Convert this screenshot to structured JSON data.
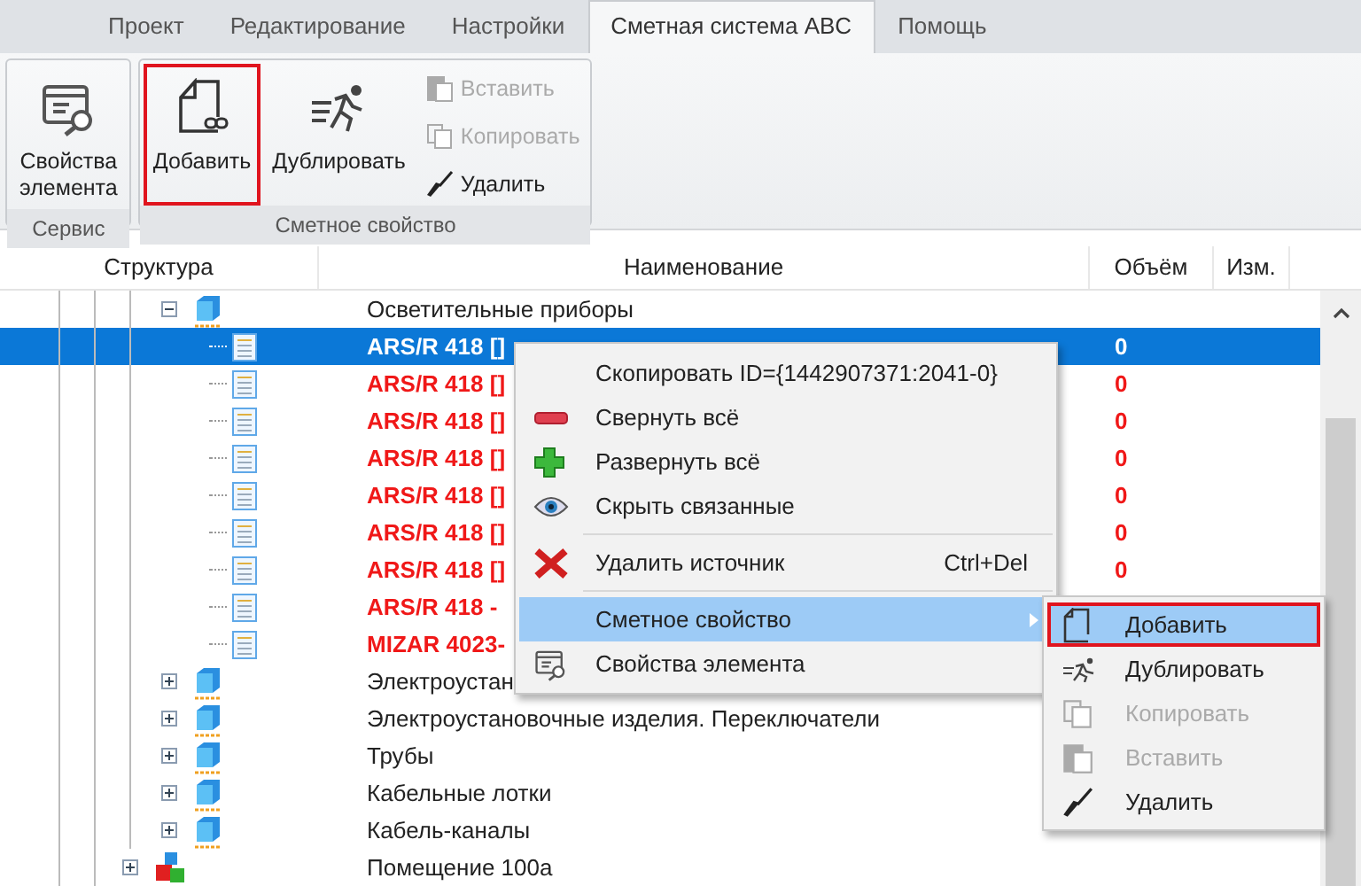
{
  "tabs": [
    {
      "label": "Проект",
      "selected": false
    },
    {
      "label": "Редактирование",
      "selected": false
    },
    {
      "label": "Настройки",
      "selected": false
    },
    {
      "label": "Сметная система ABC",
      "selected": true
    },
    {
      "label": "Помощь",
      "selected": false
    }
  ],
  "ribbon": {
    "groups": [
      {
        "title": "Сервис",
        "large_buttons": [
          {
            "label": "Свойства элемента",
            "outlined": false
          }
        ]
      },
      {
        "title": "Сметное свойство",
        "large_buttons": [
          {
            "label": "Добавить",
            "outlined": true
          },
          {
            "label": "Дублировать",
            "outlined": false
          }
        ],
        "small_buttons": [
          {
            "label": "Вставить",
            "disabled": true
          },
          {
            "label": "Копировать",
            "disabled": true
          },
          {
            "label": "Удалить",
            "disabled": false
          }
        ]
      }
    ]
  },
  "table": {
    "columns": [
      "Структура",
      "Наименование",
      "Объём",
      "Изм."
    ],
    "rows": [
      {
        "kind": "category",
        "name": "Осветительные приборы",
        "expanded": true,
        "children": [
          {
            "kind": "item",
            "name": "ARS/R 418 []",
            "volume": "0",
            "selected": true,
            "flagged": false
          },
          {
            "kind": "item",
            "name": "ARS/R 418 []",
            "volume": "0",
            "selected": false,
            "flagged": true
          },
          {
            "kind": "item",
            "name": "ARS/R 418 []",
            "volume": "0",
            "selected": false,
            "flagged": true
          },
          {
            "kind": "item",
            "name": "ARS/R 418 []",
            "volume": "0",
            "selected": false,
            "flagged": true
          },
          {
            "kind": "item",
            "name": "ARS/R 418 []",
            "volume": "0",
            "selected": false,
            "flagged": true
          },
          {
            "kind": "item",
            "name": "ARS/R 418 []",
            "volume": "0",
            "selected": false,
            "flagged": true
          },
          {
            "kind": "item",
            "name": "ARS/R 418 []",
            "volume": "0",
            "selected": false,
            "flagged": true
          },
          {
            "kind": "item",
            "name": "ARS/R 418 -",
            "selected": false,
            "flagged": true
          },
          {
            "kind": "item",
            "name": "MIZAR 4023-",
            "selected": false,
            "flagged": true
          }
        ]
      },
      {
        "kind": "category",
        "name": "Электроустан",
        "expanded": false
      },
      {
        "kind": "category",
        "name": "Электроустановочные изделия. Переключатели",
        "expanded": false
      },
      {
        "kind": "category",
        "name": "Трубы",
        "expanded": false
      },
      {
        "kind": "category",
        "name": "Кабельные лотки",
        "expanded": false
      },
      {
        "kind": "category",
        "name": "Кабель-каналы",
        "expanded": false
      },
      {
        "kind": "room",
        "name": "Помещение 100а",
        "expanded": false
      }
    ]
  },
  "context_menu": {
    "items": [
      {
        "kind": "item",
        "label": "Скопировать ID={1442907371:2041-0}",
        "selected": false
      },
      {
        "kind": "item",
        "label": "Свернуть всё",
        "selected": false
      },
      {
        "kind": "item",
        "label": "Развернуть всё",
        "selected": false
      },
      {
        "kind": "item",
        "label": "Скрыть связанные",
        "selected": false
      },
      {
        "kind": "separator"
      },
      {
        "kind": "item",
        "label": "Удалить источник",
        "shortcut": "Ctrl+Del",
        "selected": false
      },
      {
        "kind": "separator"
      },
      {
        "kind": "submenu",
        "label": "Сметное свойство",
        "selected": true
      },
      {
        "kind": "item",
        "label": "Свойства элемента",
        "selected": false
      }
    ]
  },
  "submenu": {
    "items": [
      {
        "label": "Добавить",
        "selected": true,
        "disabled": false,
        "outlined": true
      },
      {
        "label": "Дублировать",
        "selected": false,
        "disabled": false,
        "outlined": false
      },
      {
        "label": "Копировать",
        "selected": false,
        "disabled": true,
        "outlined": false
      },
      {
        "label": "Вставить",
        "selected": false,
        "disabled": true,
        "outlined": false
      },
      {
        "label": "Удалить",
        "selected": false,
        "disabled": false,
        "outlined": false
      }
    ]
  }
}
